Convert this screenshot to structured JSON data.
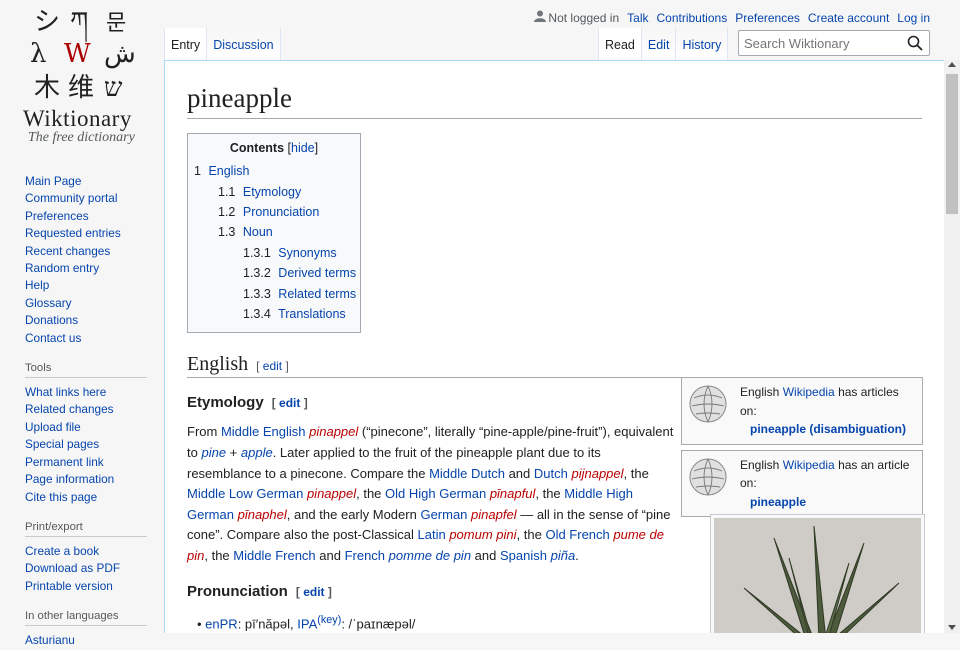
{
  "logo": {
    "name": "Wiktionary",
    "tagline": "The free dictionary"
  },
  "personal": {
    "not_logged_in": "Not logged in",
    "links": [
      "Talk",
      "Contributions",
      "Preferences",
      "Create account",
      "Log in"
    ]
  },
  "tabs": {
    "entry": "Entry",
    "discussion": "Discussion",
    "read": "Read",
    "edit": "Edit",
    "history": "History"
  },
  "search": {
    "placeholder": "Search Wiktionary"
  },
  "sidebar": {
    "navigation": [
      "Main Page",
      "Community portal",
      "Preferences",
      "Requested entries",
      "Recent changes",
      "Random entry",
      "Help",
      "Glossary",
      "Donations",
      "Contact us"
    ],
    "tools_heading": "Tools",
    "tools": [
      "What links here",
      "Related changes",
      "Upload file",
      "Special pages",
      "Permanent link",
      "Page information",
      "Cite this page"
    ],
    "print_heading": "Print/export",
    "print": [
      "Create a book",
      "Download as PDF",
      "Printable version"
    ],
    "languages_heading": "In other languages",
    "languages_partial": "Asturianu"
  },
  "page": {
    "title": "pineapple",
    "toc": {
      "title": "Contents",
      "hide": "hide",
      "entries": [
        {
          "num": "1",
          "label": "English",
          "level": 1
        },
        {
          "num": "1.1",
          "label": "Etymology",
          "level": 2
        },
        {
          "num": "1.2",
          "label": "Pronunciation",
          "level": 2
        },
        {
          "num": "1.3",
          "label": "Noun",
          "level": 2
        },
        {
          "num": "1.3.1",
          "label": "Synonyms",
          "level": 3
        },
        {
          "num": "1.3.2",
          "label": "Derived terms",
          "level": 3
        },
        {
          "num": "1.3.3",
          "label": "Related terms",
          "level": 3
        },
        {
          "num": "1.3.4",
          "label": "Translations",
          "level": 3
        }
      ]
    },
    "lang_heading": "English",
    "edit_label": "edit",
    "etymology_heading": "Etymology",
    "pronunciation_heading": "Pronunciation",
    "wikipedia_boxes": [
      {
        "prefix": "English ",
        "wp": "Wikipedia",
        "suffix": " has articles on:",
        "link": "pineapple (disambiguation)"
      },
      {
        "prefix": "English ",
        "wp": "Wikipedia",
        "suffix": " has an article on:",
        "link": "pineapple"
      }
    ],
    "etymology": {
      "t1": "From ",
      "l1": "Middle English",
      "sp": " ",
      "r1": "pinappel",
      "t2": " (“pinecone”, literally “pine-apple/pine-fruit”), equivalent to ",
      "r2": "pine",
      "plus": " + ",
      "r3": "apple",
      "t3": ". Later applied to the fruit of the pineapple plant due to its resemblance to a pinecone. Compare the ",
      "l2": "Middle Dutch",
      "and1": " and ",
      "l3": "Dutch",
      "r4": "pijnappel",
      "t4": ", the ",
      "l4": "Middle Low German",
      "r5": "pinappel",
      "t5": ", the ",
      "l5": "Old High German",
      "r6": "pīnapful",
      "t6": ", the ",
      "l6": "Middle High German",
      "r7": "pīnaphel",
      "t7": ", and the early Modern ",
      "l7": "German",
      "r8": "pinapfel",
      "t8": " — all in the sense of “pine cone”. Compare also the post-Classical ",
      "l8": "Latin",
      "r9": "pomum pini",
      "t9": ", the ",
      "l9": "Old French",
      "r10": "pume de pin",
      "t10": ", the ",
      "l10": "Middle French",
      "and2": " and ",
      "l11": "French",
      "r11": "pomme de pin",
      "and3": " and ",
      "l12": "Spanish",
      "r12": "piña",
      "end": "."
    },
    "pron": {
      "enpr_label": "enPR",
      "enpr_value": ": pī′năpəl, ",
      "ipa_label": "IPA",
      "key": "(key)",
      "ipa_value": ": /ˈpaɪnæpəl/"
    }
  }
}
